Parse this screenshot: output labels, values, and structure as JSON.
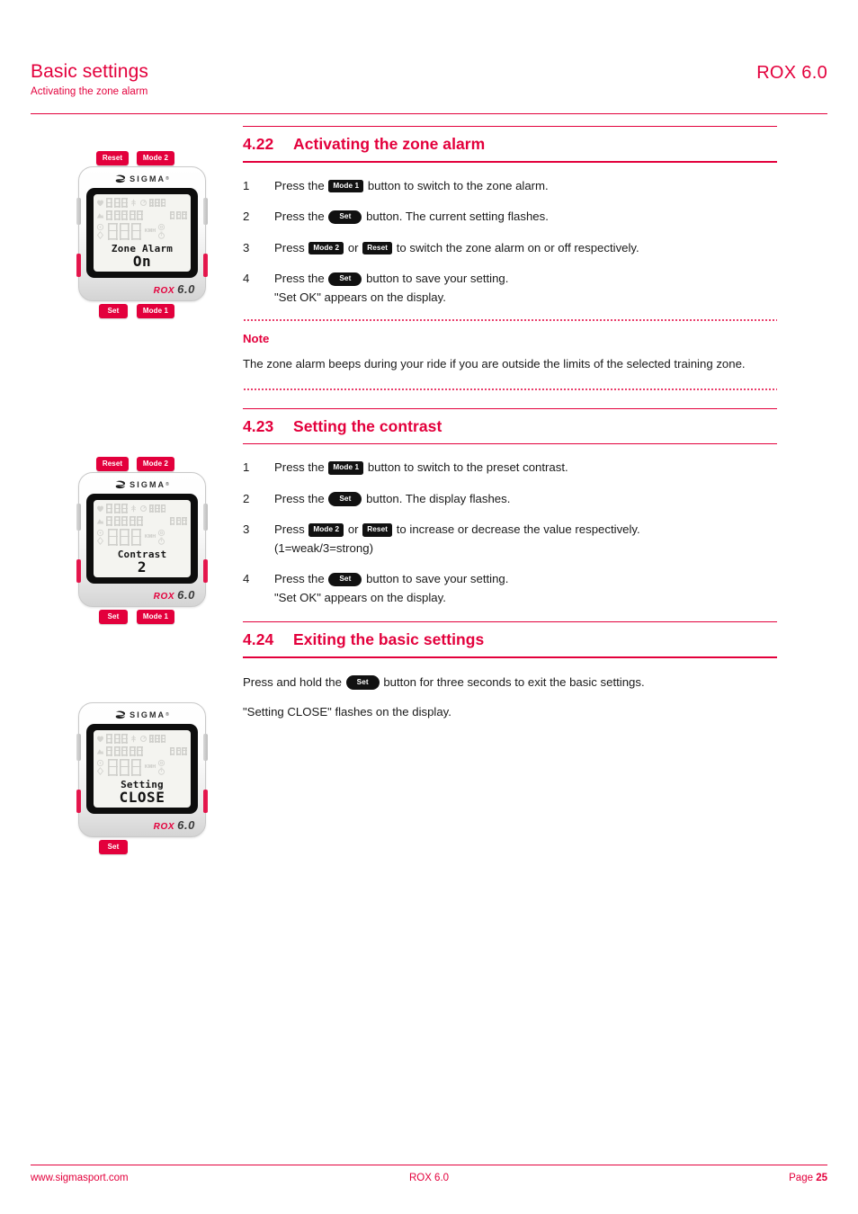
{
  "header": {
    "title": "Basic settings",
    "subtitle": "Activating the zone alarm",
    "product": "ROX 6.0"
  },
  "footer": {
    "website": "www.sigmasport.com",
    "product": "ROX 6.0",
    "page_label": "Page",
    "page_number": "25"
  },
  "colors": {
    "accent_red": "#e3003c",
    "text_black": "#1a1a1a",
    "key_black": "#111111"
  },
  "sections": [
    {
      "number": "4.22",
      "title": "Activating the zone alarm",
      "steps": [
        {
          "num": "1",
          "pre": "Press the ",
          "chip": "Mode 1",
          "chip_style": "rect",
          "post": " button to switch to the zone alarm.",
          "line2": ""
        },
        {
          "num": "2",
          "pre": "Press the ",
          "chip": "Set",
          "chip_style": "pill",
          "post": " button. The current setting flashes.",
          "line2": ""
        },
        {
          "num": "3",
          "pre": "Press ",
          "chip": "Mode 2",
          "chip_style": "rect",
          "mid": " or ",
          "chip2": "Reset",
          "chip2_style": "rect",
          "post": " to switch the zone alarm on or off respectively.",
          "line2": ""
        },
        {
          "num": "4",
          "pre": "Press the ",
          "chip": "Set",
          "chip_style": "pill",
          "post": " button to save your setting.",
          "line2": "\"Set OK\" appears on the display."
        }
      ]
    },
    {
      "number": "4.23",
      "title": "Setting the contrast",
      "steps": [
        {
          "num": "1",
          "pre": "Press the ",
          "chip": "Mode 1",
          "chip_style": "rect",
          "post": " button to switch to the preset contrast.",
          "line2": ""
        },
        {
          "num": "2",
          "pre": "Press the ",
          "chip": "Set",
          "chip_style": "pill",
          "post": " button. The display flashes.",
          "line2": ""
        },
        {
          "num": "3",
          "pre": "Press ",
          "chip": "Mode 2",
          "chip_style": "rect",
          "mid": " or ",
          "chip2": "Reset",
          "chip2_style": "rect",
          "post": " to increase or decrease the value respectively.",
          "line2": "(1=weak/3=strong)"
        },
        {
          "num": "4",
          "pre": "Press the ",
          "chip": "Set",
          "chip_style": "pill",
          "post": " button to save your setting.",
          "line2": "\"Set OK\" appears on the display."
        }
      ]
    },
    {
      "number": "4.24",
      "title": "Exiting the basic settings",
      "paragraphs": {
        "p1_pre": "Press and hold the ",
        "p1_chip": "Set",
        "p1_post": " button for three seconds to exit the basic settings.",
        "p2": "\"Setting CLOSE\" flashes on the display."
      }
    }
  ],
  "note": {
    "title": "Note",
    "text": "The zone alarm beeps during your ride if you are outside the limits of the selected training zone."
  },
  "devices": [
    {
      "id": "device-zone-alarm",
      "top_keys": [
        "Reset",
        "Mode 2"
      ],
      "bottom_keys": [
        "Set",
        "Mode 1"
      ],
      "brand": "SIGMA",
      "model_name": "ROX",
      "model_version": "6.0",
      "lcd_line1": "Zone Alarm",
      "lcd_line2": "On",
      "ghost_unit": "KMH"
    },
    {
      "id": "device-contrast",
      "top_keys": [
        "Reset",
        "Mode 2"
      ],
      "bottom_keys": [
        "Set",
        "Mode 1"
      ],
      "brand": "SIGMA",
      "model_name": "ROX",
      "model_version": "6.0",
      "lcd_line1": "Contrast",
      "lcd_line2": "2",
      "ghost_unit": "KMH"
    },
    {
      "id": "device-setting-close",
      "top_keys": [],
      "bottom_keys": [
        "Set"
      ],
      "brand": "SIGMA",
      "model_name": "ROX",
      "model_version": "6.0",
      "lcd_line1": "Setting",
      "lcd_line2": "CLOSE",
      "ghost_unit": "KMH"
    }
  ]
}
